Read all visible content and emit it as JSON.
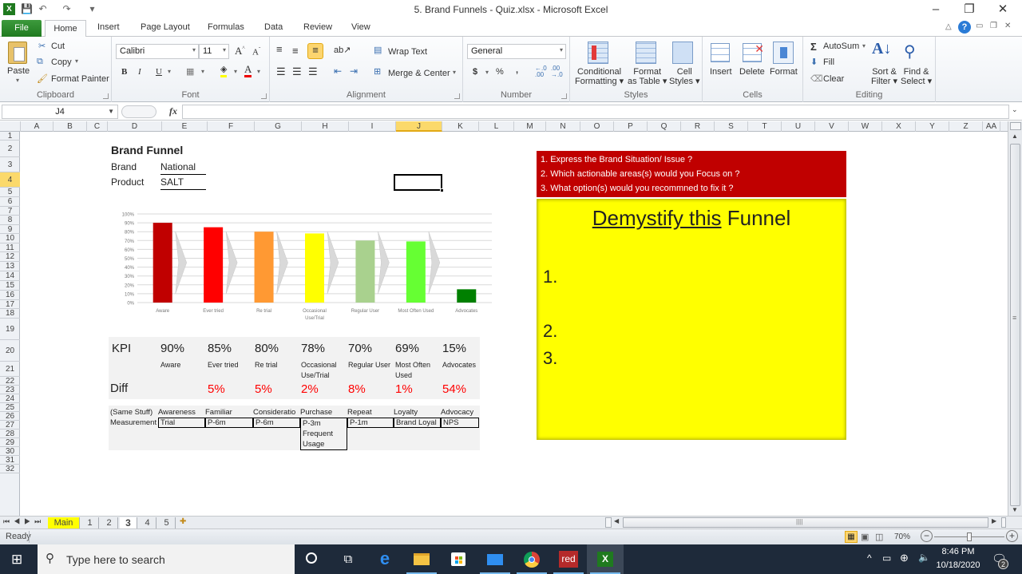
{
  "window": {
    "title": "5. Brand Funnels - Quiz.xlsx  -  Microsoft Excel",
    "controls": {
      "minimize": "–",
      "restore": "❐",
      "close": "✕"
    }
  },
  "ribbon": {
    "tabs": [
      "File",
      "Home",
      "Insert",
      "Page Layout",
      "Formulas",
      "Data",
      "Review",
      "View"
    ],
    "active_tab": "Home",
    "clipboard": {
      "label": "Clipboard",
      "paste": "Paste",
      "cut": "Cut",
      "copy": "Copy",
      "format_painter": "Format Painter"
    },
    "font": {
      "label": "Font",
      "font_name": "Calibri",
      "font_size": "11",
      "bold": "B",
      "italic": "I",
      "underline": "U"
    },
    "alignment": {
      "label": "Alignment",
      "wrap_text": "Wrap Text",
      "merge_center": "Merge & Center"
    },
    "number": {
      "label": "Number",
      "format": "General",
      "currency": "$",
      "percent": "%",
      "comma": ",",
      "inc_decimal": "+.0 .00",
      "dec_decimal": ".00 →.0"
    },
    "styles": {
      "label": "Styles",
      "conditional": [
        "Conditional",
        "Formatting"
      ],
      "format_table": [
        "Format",
        "as Table"
      ],
      "cell_styles": [
        "Cell",
        "Styles"
      ]
    },
    "cells": {
      "label": "Cells",
      "insert": "Insert",
      "delete": "Delete",
      "format": "Format"
    },
    "editing": {
      "label": "Editing",
      "autosum": "AutoSum",
      "fill": "Fill",
      "clear": "Clear",
      "sort_filter": [
        "Sort &",
        "Filter"
      ],
      "find_select": [
        "Find &",
        "Select"
      ]
    }
  },
  "formula_bar": {
    "name_box": "J4",
    "fx": "fx",
    "formula": ""
  },
  "grid": {
    "columns": [
      "A",
      "B",
      "C",
      "D",
      "E",
      "F",
      "G",
      "H",
      "I",
      "J",
      "K",
      "L",
      "M",
      "N",
      "O",
      "P",
      "Q",
      "R",
      "S",
      "T",
      "U",
      "V",
      "W",
      "X",
      "Y",
      "Z",
      "AA"
    ],
    "selected_column": "J",
    "rows": [
      "1",
      "2",
      "3",
      "4",
      "5",
      "6",
      "7",
      "8",
      "9",
      "10",
      "11",
      "12",
      "13",
      "14",
      "15",
      "16",
      "17",
      "18",
      "19",
      "20",
      "21",
      "22",
      "23",
      "24",
      "25",
      "26",
      "27",
      "28",
      "29",
      "30",
      "31",
      "32"
    ],
    "selected_row": "4",
    "selected_cell": "J4"
  },
  "sheet": {
    "heading": "Brand  Funnel",
    "brand_label": "Brand",
    "brand_value": "National",
    "product_label": "Product",
    "product_value": "SALT",
    "kpi": {
      "kpi_label": "KPI",
      "diff_label": "Diff",
      "items": [
        {
          "value": "90%",
          "name": "Aware",
          "diff": ""
        },
        {
          "value": "85%",
          "name": "Ever tried",
          "diff": "5%"
        },
        {
          "value": "80%",
          "name": "Re trial",
          "diff": "5%"
        },
        {
          "value": "78%",
          "name": "Occasional Use/Trial",
          "diff": "2%"
        },
        {
          "value": "70%",
          "name": "Regular User",
          "diff": "8%"
        },
        {
          "value": "69%",
          "name": "Most Often Used",
          "diff": "1%"
        },
        {
          "value": "15%",
          "name": "Advocates",
          "diff": "54%"
        }
      ]
    },
    "measurement": {
      "row1_label": "(Same Stuff)",
      "row2_label": "Measurement",
      "stages": [
        "Awareness",
        "Familiar",
        "Consideratio",
        "Purchase",
        "Repeat",
        "Loyalty",
        "Advocacy"
      ],
      "measures": [
        "Trial",
        "P-6m",
        "P-6m",
        "P-3m Frequent Usage",
        "P-1m",
        "Brand Loyal",
        "NPS"
      ]
    },
    "questions": [
      "1. Express the Brand Situation/ Issue ?",
      "2.  Which actionable areas(s) would you Focus on ?",
      "3. What option(s) would you recommned to fix it ?"
    ],
    "answer_box": {
      "title_underlined": "Demystify this",
      "title_rest": " Funnel",
      "items": [
        "1.",
        "2.",
        "3."
      ]
    }
  },
  "chart_data": {
    "type": "bar",
    "title": "",
    "xlabel": "",
    "ylabel": "",
    "categories": [
      "Aware",
      "Ever tried",
      "Re trial",
      "Occasional Use/Trial",
      "Regular User",
      "Most Often Used",
      "Advocates"
    ],
    "values": [
      90,
      85,
      80,
      78,
      70,
      69,
      15
    ],
    "colors": [
      "#c00000",
      "#ff0000",
      "#ff9933",
      "#ffff00",
      "#a9d18e",
      "#66ff33",
      "#008000"
    ],
    "yticks": [
      "0%",
      "10%",
      "20%",
      "30%",
      "40%",
      "50%",
      "60%",
      "70%",
      "80%",
      "90%",
      "100%"
    ],
    "ylim": [
      0,
      100
    ],
    "grid": true,
    "legend": "none",
    "annotations": "grey chevron arrows between bars"
  },
  "sheet_tabs": {
    "tabs": [
      "Main",
      "1",
      "2",
      "3",
      "4",
      "5"
    ],
    "active": "3",
    "highlighted": "Main"
  },
  "status": {
    "ready": "Ready",
    "zoom": "70%",
    "zoom_fraction": 0.5
  },
  "taskbar": {
    "search_placeholder": "Type here to search",
    "apps": [
      "cortana",
      "task-view",
      "edge",
      "file-explorer",
      "store",
      "mail",
      "chrome",
      "red-app",
      "excel"
    ],
    "red_app_label": "red",
    "time": "8:46 PM",
    "date": "10/18/2020",
    "notifications": "2"
  },
  "colors": {
    "question_bg": "#c00000",
    "answer_bg": "#ffff00",
    "diff_red": "#ff0000",
    "selection": "#fbd96b",
    "excel_green": "#1f7a1f"
  }
}
